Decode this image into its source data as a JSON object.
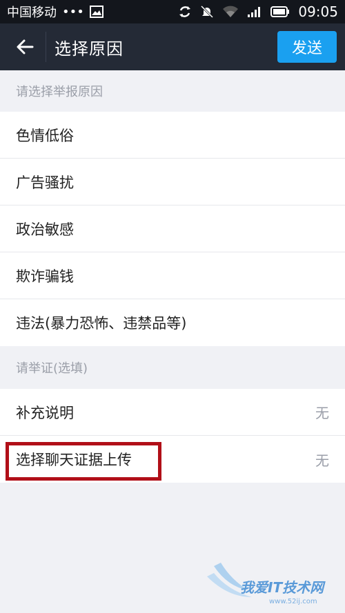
{
  "status_bar": {
    "carrier": "中国移动",
    "dots": "•••",
    "time": "09:05"
  },
  "topbar": {
    "title": "选择原因",
    "send_label": "发送"
  },
  "report_reasons": {
    "header": "请选择举报原因",
    "items": [
      {
        "label": "色情低俗"
      },
      {
        "label": "广告骚扰"
      },
      {
        "label": "政治敏感"
      },
      {
        "label": "欺诈骗钱"
      },
      {
        "label": "违法(暴力恐怖、违禁品等)"
      }
    ]
  },
  "evidence": {
    "header": "请举证(选填)",
    "items": [
      {
        "label": "补充说明",
        "value": "无"
      },
      {
        "label": "选择聊天证据上传",
        "value": "无"
      }
    ]
  },
  "watermark": {
    "text": "我爱IT技术网",
    "url": "www.52ij.com"
  },
  "colors": {
    "topbar": "#242a36",
    "send": "#1aa0f0",
    "highlight": "#b10f18"
  }
}
